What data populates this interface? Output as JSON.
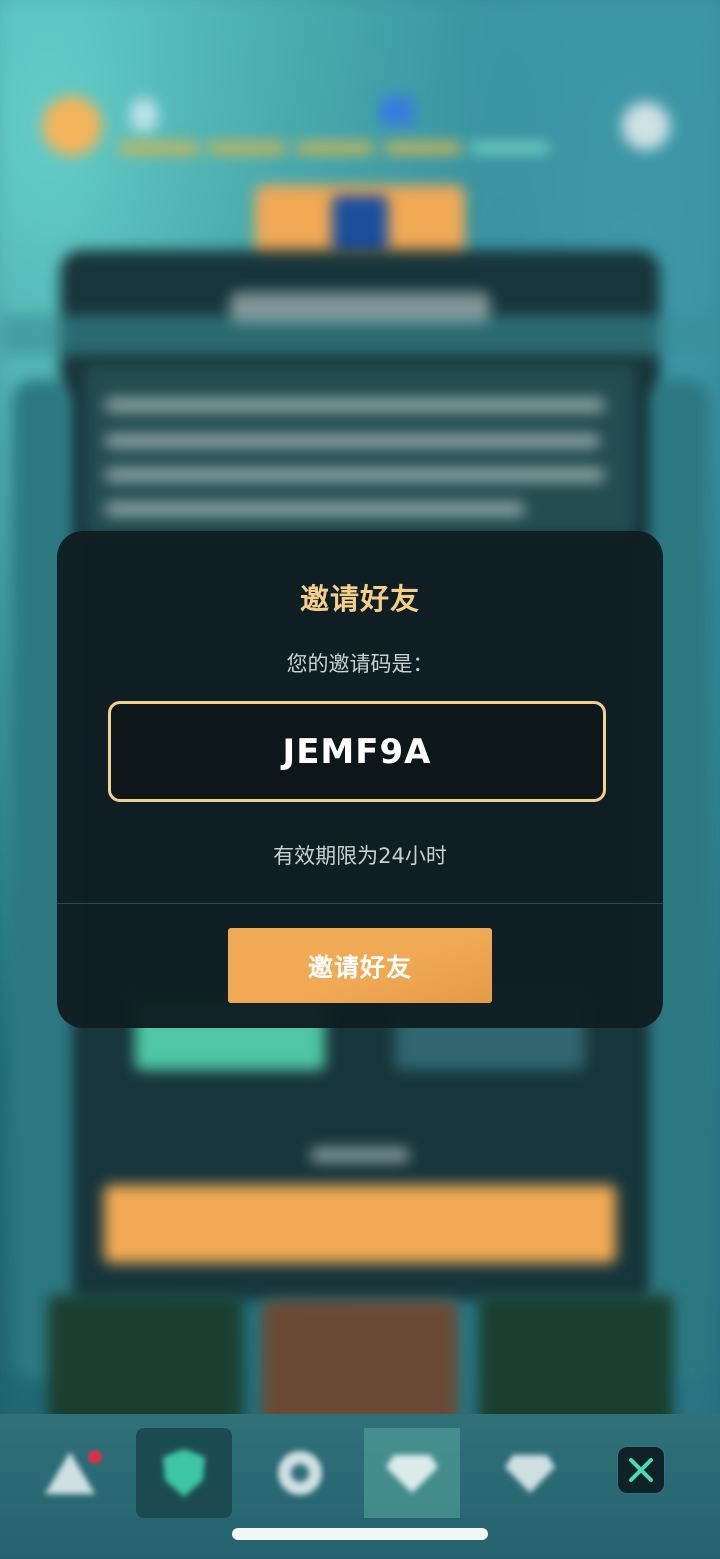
{
  "dialog": {
    "title": "邀请好友",
    "subtitle": "您的邀请码是：",
    "invite_code": "JEMF9A",
    "validity": "有效期限为24小时",
    "invite_button_label": "邀请好友"
  },
  "icons": {
    "close": "close-icon"
  },
  "colors": {
    "accent_gold": "#f5cf8a",
    "button_orange": "#f0aa55",
    "dialog_bg": "#101e22"
  }
}
